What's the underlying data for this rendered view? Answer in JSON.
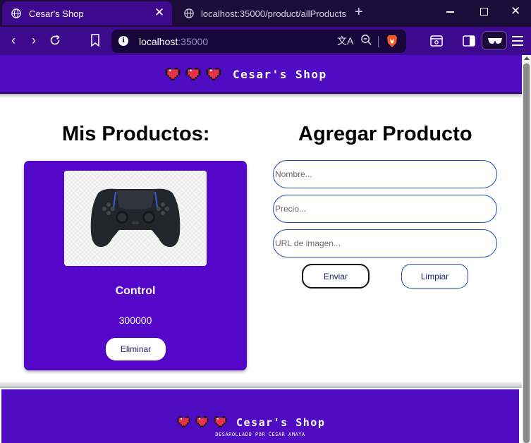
{
  "browser": {
    "active_tab": {
      "title": "Cesar's Shop",
      "close": "✕"
    },
    "inactive_tab": {
      "title": "localhost:35000/product/allProducts"
    },
    "new_tab": "+",
    "url": {
      "host": "localhost",
      "port": ":35000"
    }
  },
  "site": {
    "brand": "Cesar's Shop",
    "footer_credit": "DESAROLLADO POR CESAR AMAYA"
  },
  "products_section": {
    "title": "Mis Productos:",
    "products": [
      {
        "name": "Control",
        "price": "300000",
        "delete_label": "Eliminar"
      }
    ]
  },
  "add_section": {
    "title": "Agregar Producto",
    "name_placeholder": "Nombre...",
    "price_placeholder": "Precio...",
    "url_placeholder": "URL de imagen...",
    "send_label": "Enviar",
    "clear_label": "Limpiar"
  },
  "colors": {
    "brand_purple": "#4f0cc2",
    "card_purple": "#5407c8",
    "chrome_dark": "#1b0c3a",
    "chrome_bar": "#3d0a8e",
    "input_border": "#1f4fb8"
  }
}
